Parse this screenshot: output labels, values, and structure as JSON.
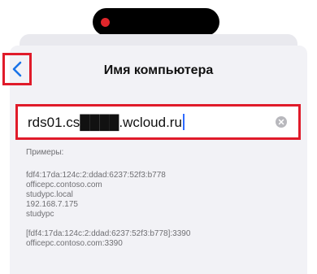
{
  "nav": {
    "title": "Имя компьютера"
  },
  "field": {
    "value": "rds01.cs████.wcloud.ru"
  },
  "examples": {
    "heading": "Примеры:",
    "lines_group1": [
      "fdf4:17da:124c:2:ddad:6237:52f3:b778",
      "officepc.contoso.com",
      "studypc.local",
      "192.168.7.175",
      "studypc"
    ],
    "lines_group2": [
      "[fdf4:17da:124c:2:ddad:6237:52f3:b778]:3390",
      "officepc.contoso.com:3390"
    ]
  },
  "icons": {
    "back": "chevron-left-icon",
    "clear": "clear-x-icon"
  },
  "colors": {
    "accent": "#1a73e8",
    "highlight": "#e01b2a",
    "secondary_text": "#6f6f73"
  }
}
